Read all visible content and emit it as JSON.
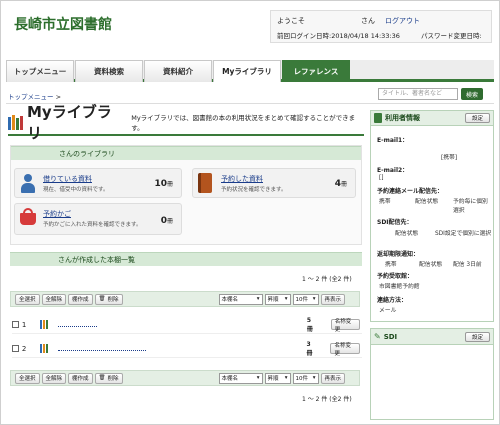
{
  "header": {
    "site_title": "長崎市立図書館",
    "welcome": "ようこそ",
    "san": "さん",
    "logout": "ログアウト",
    "last_login": "前回ログイン日時:2018/04/18 14:33:36",
    "password_changed": "パスワード変更日時:"
  },
  "nav": {
    "tabs": [
      "トップメニュー",
      "資料検索",
      "資料紹介",
      "Myライブラリ",
      "レファレンス"
    ]
  },
  "search": {
    "placeholder": "タイトル、著者名など",
    "button": "検索"
  },
  "breadcrumb": {
    "home": "トップメニュー",
    "sep": ">"
  },
  "main": {
    "title": "Myライブラリ",
    "description": "Myライブラリでは、図書館の本の利用状況をまとめて確認することができます。",
    "library_heading": "さんのライブラリ",
    "cards": {
      "borrowing": {
        "name": "借りている資料",
        "desc": "現在、借受中の資料です。",
        "count": "10",
        "unit": "冊"
      },
      "reserved": {
        "name": "予約した資料",
        "desc": "予約状況を確認できます。",
        "count": "4",
        "unit": "冊"
      },
      "cart": {
        "name": "予約かご",
        "desc": "予約かごに入れた資料を確認できます。",
        "count": "0",
        "unit": "冊"
      }
    },
    "shelf_heading": "さんが作成した本棚一覧",
    "pagination": "1 ～ 2 件 (全2 件)",
    "toolbar": {
      "select_all": "全選択",
      "deselect_all": "全解除",
      "create_shelf": "棚作成",
      "delete": "削除",
      "sort_field": "本棚名",
      "sort_order": "昇順",
      "per_page": "10件",
      "redisplay": "再表示"
    },
    "rows": [
      {
        "num": "1",
        "count": "5冊",
        "rename": "名称変更"
      },
      {
        "num": "2",
        "count": "3冊",
        "rename": "名称変更"
      }
    ]
  },
  "sidebar": {
    "user_info": {
      "title": "利用者情報",
      "settings": "設定",
      "email1_label": "E-mail1：",
      "mobile": "[携帯]",
      "email2_label": "E-mail2：",
      "email2_value": "[]",
      "reserve_mail_label": "予約連絡メール配信先：",
      "reserve_mail_value_a": "携帯",
      "reserve_mail_value_b": "配信状態",
      "reserve_mail_value_c": "予約毎に個別選択",
      "sdi_label": "SDI配信先：",
      "sdi_value_a": "配信状態",
      "sdi_value_b": "SDI設定で個別に選択",
      "return_label": "返却期限通知：",
      "return_value_a": "携帯",
      "return_value_b": "配信状態",
      "return_value_c": "配信 3日前",
      "pickup_label": "予約受取館：",
      "pickup_value": "市図書館予約館",
      "contact_label": "連絡方法：",
      "contact_value": "メール"
    },
    "sdi": {
      "title": "SDI",
      "settings": "設定"
    }
  },
  "colors": {
    "accent": "#3a7a3a",
    "header_bg": "#d6e9d6"
  }
}
